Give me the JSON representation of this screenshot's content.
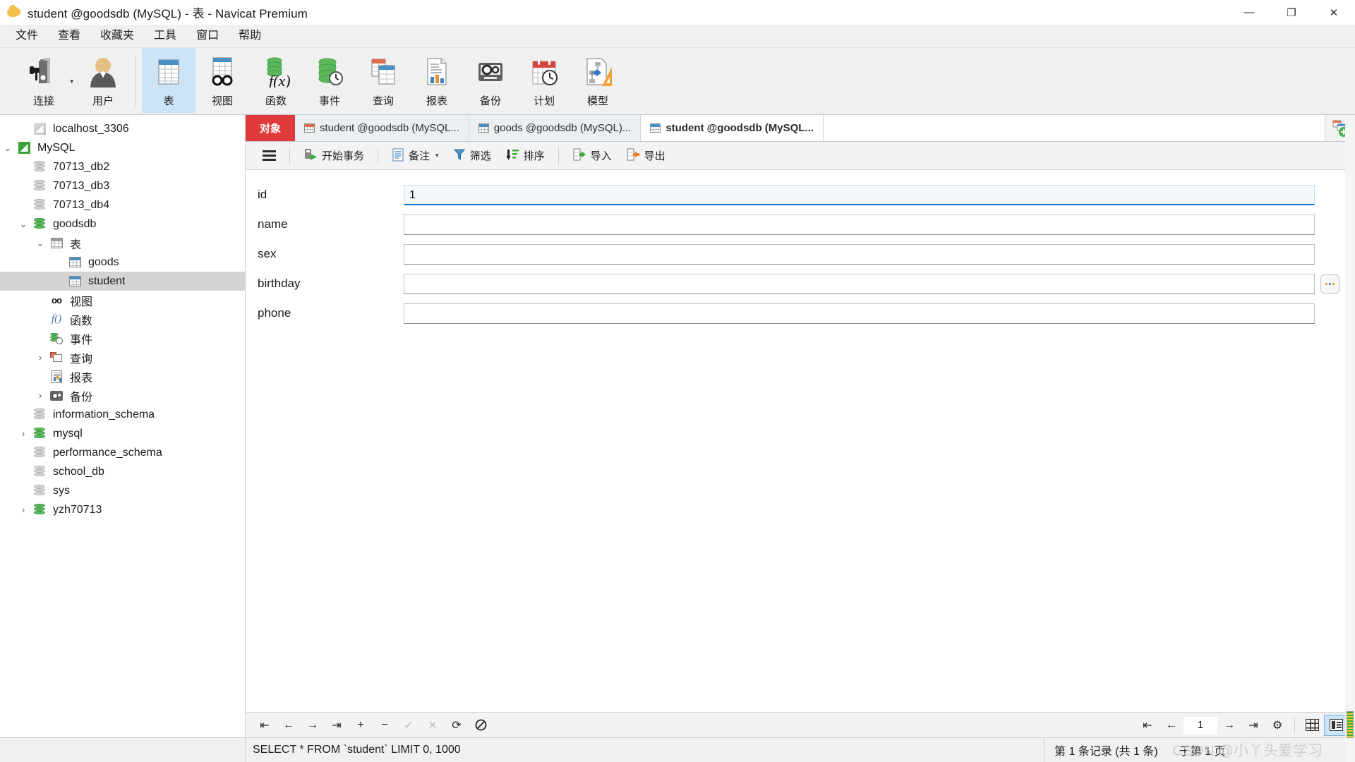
{
  "window": {
    "title": "student @goodsdb (MySQL) - 表 - Navicat Premium",
    "minimize": "—",
    "maximize": "❐",
    "close": "✕"
  },
  "menu": {
    "items": [
      {
        "label": "文件"
      },
      {
        "label": "查看"
      },
      {
        "label": "收藏夹"
      },
      {
        "label": "工具"
      },
      {
        "label": "窗口"
      },
      {
        "label": "帮助"
      }
    ]
  },
  "toolbar": {
    "items": [
      {
        "label": "连接",
        "icon": "connection-icon",
        "has_caret": true
      },
      {
        "label": "用户",
        "icon": "user-icon",
        "has_caret": false
      },
      {
        "label": "表",
        "icon": "table-icon",
        "active": true
      },
      {
        "label": "视图",
        "icon": "view-icon"
      },
      {
        "label": "函数",
        "icon": "function-icon"
      },
      {
        "label": "事件",
        "icon": "event-icon"
      },
      {
        "label": "查询",
        "icon": "query-icon"
      },
      {
        "label": "报表",
        "icon": "report-icon"
      },
      {
        "label": "备份",
        "icon": "backup-icon"
      },
      {
        "label": "计划",
        "icon": "schedule-icon"
      },
      {
        "label": "模型",
        "icon": "model-icon"
      }
    ]
  },
  "sidebar": {
    "nodes": [
      {
        "label": "localhost_3306",
        "indent": 1,
        "twisty": "",
        "icon": "host-icon"
      },
      {
        "label": "MySQL",
        "indent": 0,
        "twisty": "v",
        "icon": "mysql-icon"
      },
      {
        "label": "70713_db2",
        "indent": 2,
        "twisty": "",
        "icon": "database-grey-icon"
      },
      {
        "label": "70713_db3",
        "indent": 2,
        "twisty": "",
        "icon": "database-grey-icon"
      },
      {
        "label": "70713_db4",
        "indent": 2,
        "twisty": "",
        "icon": "database-grey-icon"
      },
      {
        "label": "goodsdb",
        "indent": 1,
        "twisty": "v",
        "icon": "database-green-icon"
      },
      {
        "label": "表",
        "indent": 2,
        "twisty": "v",
        "icon": "table-folder-icon"
      },
      {
        "label": "goods",
        "indent": 4,
        "twisty": "",
        "icon": "table-icon"
      },
      {
        "label": "student",
        "indent": 4,
        "twisty": "",
        "icon": "table-icon",
        "selected": true
      },
      {
        "label": "视图",
        "indent": 3,
        "twisty": "",
        "icon": "view-icon"
      },
      {
        "label": "函数",
        "indent": 3,
        "twisty": "",
        "icon": "function-icon"
      },
      {
        "label": "事件",
        "indent": 3,
        "twisty": "",
        "icon": "event-icon"
      },
      {
        "label": "查询",
        "indent": 2,
        "twisty": ">",
        "icon": "query-icon"
      },
      {
        "label": "报表",
        "indent": 3,
        "twisty": "",
        "icon": "report-icon"
      },
      {
        "label": "备份",
        "indent": 2,
        "twisty": ">",
        "icon": "backup-icon"
      },
      {
        "label": "information_schema",
        "indent": 2,
        "twisty": "",
        "icon": "database-grey-icon"
      },
      {
        "label": "mysql",
        "indent": 1,
        "twisty": ">",
        "icon": "database-green-icon"
      },
      {
        "label": "performance_schema",
        "indent": 2,
        "twisty": "",
        "icon": "database-grey-icon"
      },
      {
        "label": "school_db",
        "indent": 2,
        "twisty": "",
        "icon": "database-grey-icon"
      },
      {
        "label": "sys",
        "indent": 2,
        "twisty": "",
        "icon": "database-grey-icon"
      },
      {
        "label": "yzh70713",
        "indent": 1,
        "twisty": ">",
        "icon": "database-green-icon"
      }
    ]
  },
  "tabs": {
    "object_tab": "对象",
    "items": [
      {
        "label": "student @goodsdb (MySQL...",
        "icon": "query-table-icon",
        "active": false
      },
      {
        "label": "goods @goodsdb (MySQL)...",
        "icon": "table-icon",
        "active": false
      },
      {
        "label": "student @goodsdb (MySQL...",
        "icon": "table-icon",
        "active": true
      }
    ],
    "add_tab_icon": "new-tab-icon"
  },
  "actionbar": {
    "menu_icon": "hamburger-icon",
    "buttons": [
      {
        "label": "开始事务",
        "icon": "begin-transaction-icon",
        "has_caret": false
      },
      {
        "label": "备注",
        "icon": "note-icon",
        "has_caret": true
      },
      {
        "label": "筛选",
        "icon": "filter-icon",
        "has_caret": false
      },
      {
        "label": "排序",
        "icon": "sort-icon",
        "has_caret": false
      },
      {
        "label": "导入",
        "icon": "import-icon",
        "has_caret": false
      },
      {
        "label": "导出",
        "icon": "export-icon",
        "has_caret": false
      }
    ]
  },
  "form": {
    "fields": [
      {
        "label": "id",
        "value": "1",
        "focused": true,
        "has_ellipsis": false
      },
      {
        "label": "name",
        "value": "",
        "focused": false,
        "has_ellipsis": false
      },
      {
        "label": "sex",
        "value": "",
        "focused": false,
        "has_ellipsis": false
      },
      {
        "label": "birthday",
        "value": "",
        "focused": false,
        "has_ellipsis": true
      },
      {
        "label": "phone",
        "value": "",
        "focused": false,
        "has_ellipsis": false
      }
    ]
  },
  "recordnav": {
    "left_buttons": [
      {
        "icon": "first-record-icon",
        "glyph": "⇤",
        "disabled": false
      },
      {
        "icon": "prev-record-icon",
        "glyph": "←",
        "disabled": false
      },
      {
        "icon": "next-record-icon",
        "glyph": "→",
        "disabled": false
      },
      {
        "icon": "last-record-icon",
        "glyph": "⇥",
        "disabled": false
      },
      {
        "icon": "add-record-icon",
        "glyph": "+",
        "disabled": false
      },
      {
        "icon": "delete-record-icon",
        "glyph": "−",
        "disabled": false
      },
      {
        "icon": "apply-change-icon",
        "glyph": "✓",
        "disabled": true
      },
      {
        "icon": "cancel-change-icon",
        "glyph": "✕",
        "disabled": true
      },
      {
        "icon": "refresh-icon",
        "glyph": "⟳",
        "disabled": false
      },
      {
        "icon": "stop-icon",
        "glyph": "🚫",
        "disabled": false
      }
    ],
    "right_buttons": [
      {
        "icon": "first-page-icon",
        "glyph": "⇤"
      },
      {
        "icon": "prev-page-icon",
        "glyph": "←"
      }
    ],
    "page_value": "1",
    "right_buttons2": [
      {
        "icon": "next-page-icon",
        "glyph": "→"
      },
      {
        "icon": "last-page-icon",
        "glyph": "⇥"
      },
      {
        "icon": "settings-gear-icon",
        "glyph": "⚙"
      }
    ],
    "view_modes": [
      {
        "icon": "grid-view-icon",
        "selected": false
      },
      {
        "icon": "form-view-icon",
        "selected": true
      }
    ]
  },
  "statusbar": {
    "sql": "SELECT * FROM `student` LIMIT 0, 1000",
    "record_info": "第 1 条记录 (共 1 条)",
    "page_info": "于第 1 页",
    "watermark": "CSDN @小丫头爱学习"
  }
}
